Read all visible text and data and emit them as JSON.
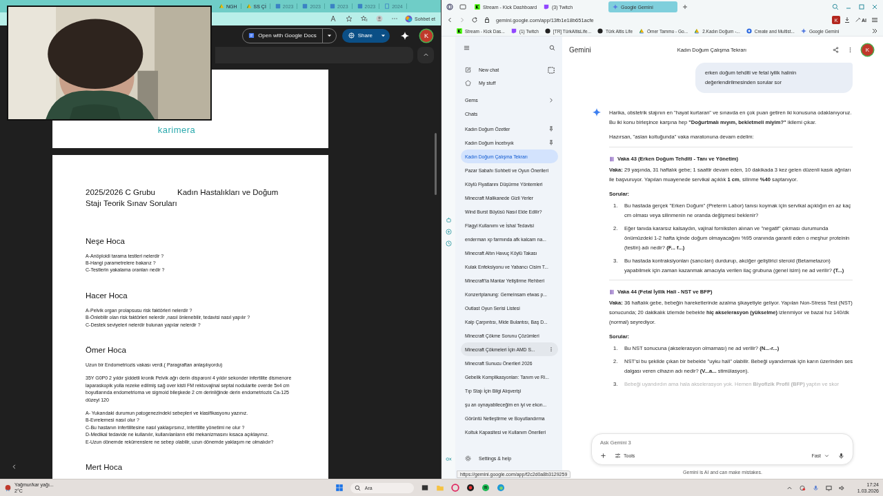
{
  "left_browser": {
    "tabs": [
      {
        "label": "NGH",
        "kind": "drive"
      },
      {
        "label": "SS Çİ",
        "kind": "drive"
      },
      {
        "label": "2023",
        "kind": "doc"
      },
      {
        "label": "2023",
        "kind": "doc"
      },
      {
        "label": "2023",
        "kind": "doc"
      },
      {
        "label": "2023",
        "kind": "doc"
      },
      {
        "label": "2024",
        "kind": "page"
      }
    ],
    "copilot_label": "Sohbet et"
  },
  "drive_viewer": {
    "open_with": "Open with Google Docs",
    "share": "Share",
    "avatar": "K"
  },
  "document": {
    "page1_text": "karimera",
    "title": "2025/2026 C Grubu          Kadın Hastalıkları ve Doğum Stajı Teorik Sınav Soruları",
    "sections": [
      {
        "heading": "Neşe Hoca",
        "blocks": [
          [
            "A-Anöploidi tarama testleri nelerdir ?",
            "B-Hangi parametrelere bakarız ?",
            "C-Testlerin yakalama oranları nedir ?"
          ]
        ]
      },
      {
        "heading": "Hacer Hoca",
        "blocks": [
          [
            "A-Pelvik organ prolapsusu risk faktörleri nelerdir ?",
            "B-Önlebilir olan risk faktörleri nelerdir ,nasıl önlenebilir, tedavisi nasıl yapılır ?",
            "C-Destek seviyeleri nelerdir bulunan yapılar nelerdir ?"
          ]
        ]
      },
      {
        "heading": "Ömer Hoca",
        "blocks": [
          [
            "Uzun bir Endometriozis vakası verdi.( Paragraftan anlaşılıyordu)"
          ],
          [
            "35Y G0P0 2 yıldır şiddetli kronik Pelvik ağrı derin disparoni 4 yıldır sekonder infertilite dismenore laparaskopik yolla rezeke edilmiş sağ over kisti FM rektovajinal septal nodularite overde 5x4 cm boyutlarında endometrioma ve sigmoid bileşkede 2 cm derinliğinde derin endometriozis Ca-125 düzeyi 120"
          ],
          [
            "A- Yukarıdaki durumun patogenezindeki sebepleri ve klasifikasyonu yazınız.",
            "B-Evrelemesi nasıl olur ?",
            "C-Bu hastanın infertilitesine nasıl yaklaşırsınız, infertilite yönetimi ne olur ?",
            "D-Medikal tedavide ne kullanılır, kullanılanların etki mekanizmasını kısaca açıklayınız.",
            "E-Uzun dönemde rekürrenslere ne  sebep olabilir, uzun dönemde yaklaşım ne olmalıdır?"
          ]
        ]
      },
      {
        "heading": "Mert Hoca"
      }
    ]
  },
  "right_browser": {
    "tabs": [
      {
        "label": "Stream - Kick Dashboard",
        "selected": false
      },
      {
        "label": "(3) Twitch",
        "selected": false
      },
      {
        "label": "Google Gemini",
        "selected": true
      }
    ],
    "url": "gemini.google.com/app/13fb1e18b651acfe",
    "profile": "K",
    "ai_label": "AI",
    "bookmarks": [
      "Stream - Kick Das...",
      "(1) Twitch",
      "[TR] TürkAltisLife...",
      "Türk Altis Life",
      "Ömer Tammo - Go...",
      "2.Kadın Doğum -...",
      "Create and Multist...",
      "Google Gemini"
    ]
  },
  "gemini": {
    "brand": "Gemini",
    "chat_title": "Kadın Doğum Çalışma Tekrarı",
    "avatar": "K",
    "sidebar": {
      "new_chat": "New chat",
      "my_stuff": "My stuff",
      "gems": "Gems",
      "chats_heading": "Chats",
      "settings": "Settings & help",
      "chats": [
        {
          "label": "Kadın Doğum Özetler",
          "pinned": true,
          "selected": false,
          "hovered": false
        },
        {
          "label": "Kadın Doğum İncebıyık",
          "pinned": true,
          "selected": false,
          "hovered": false
        },
        {
          "label": "Kadın Doğum Çalışma Tekrarı",
          "pinned": false,
          "selected": true,
          "hovered": false
        },
        {
          "label": "Pazar Sabahı Sohbeti ve Oyun Önerileri",
          "pinned": false,
          "selected": false,
          "hovered": false
        },
        {
          "label": "Köylü Fiyatlarını Düşürme Yöntemleri",
          "pinned": false,
          "selected": false,
          "hovered": false
        },
        {
          "label": "Minecraft Malikanede Gizli Yerler",
          "pinned": false,
          "selected": false,
          "hovered": false
        },
        {
          "label": "Wind Burst Büyüsü Nasıl Elde Edilir?",
          "pinned": false,
          "selected": false,
          "hovered": false
        },
        {
          "label": "Flagyl Kullanımı ve İshal Tedavisi",
          "pinned": false,
          "selected": false,
          "hovered": false
        },
        {
          "label": "enderman xp farmında afk kalcam na...",
          "pinned": false,
          "selected": false,
          "hovered": false
        },
        {
          "label": "Minecraft Altın Havuç Köylü Takası",
          "pinned": false,
          "selected": false,
          "hovered": false
        },
        {
          "label": "Kulak Enfeksiyonu ve Yabancı Cisim T...",
          "pinned": false,
          "selected": false,
          "hovered": false
        },
        {
          "label": "Minecraft'ta Mantar Yetiştirme Rehberi",
          "pinned": false,
          "selected": false,
          "hovered": false
        },
        {
          "label": "Konzertplanung: Gemeinsam etwas p...",
          "pinned": false,
          "selected": false,
          "hovered": false
        },
        {
          "label": "Outlast Oyun Serisi Listesi",
          "pinned": false,
          "selected": false,
          "hovered": false
        },
        {
          "label": "Kalp Çarpıntısı, Mide Bulantısı, Baş D...",
          "pinned": false,
          "selected": false,
          "hovered": false
        },
        {
          "label": "Minecraft Çökme Sorunu Çözümleri",
          "pinned": false,
          "selected": false,
          "hovered": false
        },
        {
          "label": "Minecraft Çökmeleri İçin AMD S...",
          "pinned": false,
          "selected": false,
          "hovered": true
        },
        {
          "label": "Minecraft Sunucu Önerileri 2026",
          "pinned": false,
          "selected": false,
          "hovered": false
        },
        {
          "label": "Gebelik Komplikasyonları: Tanım ve Ri...",
          "pinned": false,
          "selected": false,
          "hovered": false
        },
        {
          "label": "Tıp Stajı İçin Bilgi Alışverişi",
          "pinned": false,
          "selected": false,
          "hovered": false
        },
        {
          "label": "şu an oynayabileceğim en iyi ve ekon...",
          "pinned": false,
          "selected": false,
          "hovered": false
        },
        {
          "label": "Görüntü Netleştirme ve Boyutlandırma",
          "pinned": false,
          "selected": false,
          "hovered": false
        },
        {
          "label": "Koltuk Kapasitesi ve Kullanım Önerileri",
          "pinned": false,
          "selected": false,
          "hovered": false
        }
      ]
    },
    "user_message": "erken doğum tehditi ve fetal iyilik halinin değerlendirilmesinden sorular sor",
    "response": {
      "intro": [
        "Harika, obstetrik stajının en \"hayat kurtaran\" ve sınavda en çok puan getiren iki konusuna odaklanıyoruz. Bu iki konu birleşince karşına hep **\"Doğurtmalı mıyım, bekletmeli miyim?\"** ikilemi çıkar.",
        "Hazırsan, \"aslan koltuğunda\" vaka maratonuna devam edelim:"
      ],
      "cases": [
        {
          "title": "Vaka 43 (Erken Doğum Tehditi - Tanı ve Yönetim)",
          "vaka": "**Vaka:** 29 yaşında, 31 haftalık gebe; 1 saattir devam eden, 10 dakikada 3 kez gelen düzenli kasık ağrıları ile başvuruyor. Yapılan muayenede servikal açıklık **1 cm**, silinme **%40** saptanıyor.",
          "questions_label": "Sorular:",
          "questions": [
            {
              "number": "1.",
              "text": "Bu hastada gerçek \"Erken Doğum\" (Preterm Labor) tanısı koymak için servikal açıklığın en az kaç cm olması veya silinmenin ne oranda değişmesi beklenir?",
              "faded": false
            },
            {
              "number": "2.",
              "text": "Eğer tanıda kararsız kalsaydın, vajinal forniksten alınan ve \"negatif\" çıkması durumunda önümüzdeki 1-2 hafta içinde doğum olmayacağını %95 oranında garanti eden o meşhur proteinin (testin) adı nedir? **(F... f...)**",
              "faded": false
            },
            {
              "number": "3.",
              "text": "Bu hastada kontraksiyonları (sancıları) durdurup, akciğer geliştirici steroid (Betametazon) yapabilmek için zaman kazanmak amacıyla verilen ilaç grubuna (genel isim) ne ad verilir? **(T...)**",
              "faded": false
            }
          ]
        },
        {
          "title": "Vaka 44 (Fetal İyilik Hali - NST ve BFP)",
          "vaka": "**Vaka:** 36 haftalık gebe, bebeğin hareketlerinde azalma şikayetiyle geliyor. Yapılan Non-Stress Test (NST) sonucunda; 20 dakikalık izlemde bebekte **hiç akselerasyon (yükselme)** izlenmiyor ve bazal hız 140/dk (normal) seyrediyor.",
          "questions_label": "Sorular:",
          "questions": [
            {
              "number": "1.",
              "text": "Bu NST sonucuna (akselerasyon olmaması) ne ad verilir? **(N...-r...)**",
              "faded": false
            },
            {
              "number": "2.",
              "text": "NST'si bu şekilde çıkan bir bebekte \"uyku hali\" olabilir. Bebeği uyandırmak için karın üzerinden ses dalgası veren cihazın adı nedir? **(V...a...** stimülasyon).",
              "faded": false
            },
            {
              "number": "3.",
              "text": "Bebeği uyandırdın ama hala akselerasyon yok. Hemen **Biyofizik Profil (BFP)** yaptın ve skor",
              "faded": true
            }
          ]
        }
      ]
    },
    "input": {
      "placeholder": "Ask Gemini 3",
      "tools": "Tools",
      "mode": "Fast"
    },
    "disclaimer": "Gemini is AI and can make mistakes."
  },
  "status_url": "https://gemini.google.com/app/f2c2d0a8b3129259",
  "taskbar": {
    "weather": "Yağmur/kar yağı...",
    "temperature": "2°C",
    "search": "Ara",
    "time": "17:24",
    "date": "1.03.2026"
  }
}
